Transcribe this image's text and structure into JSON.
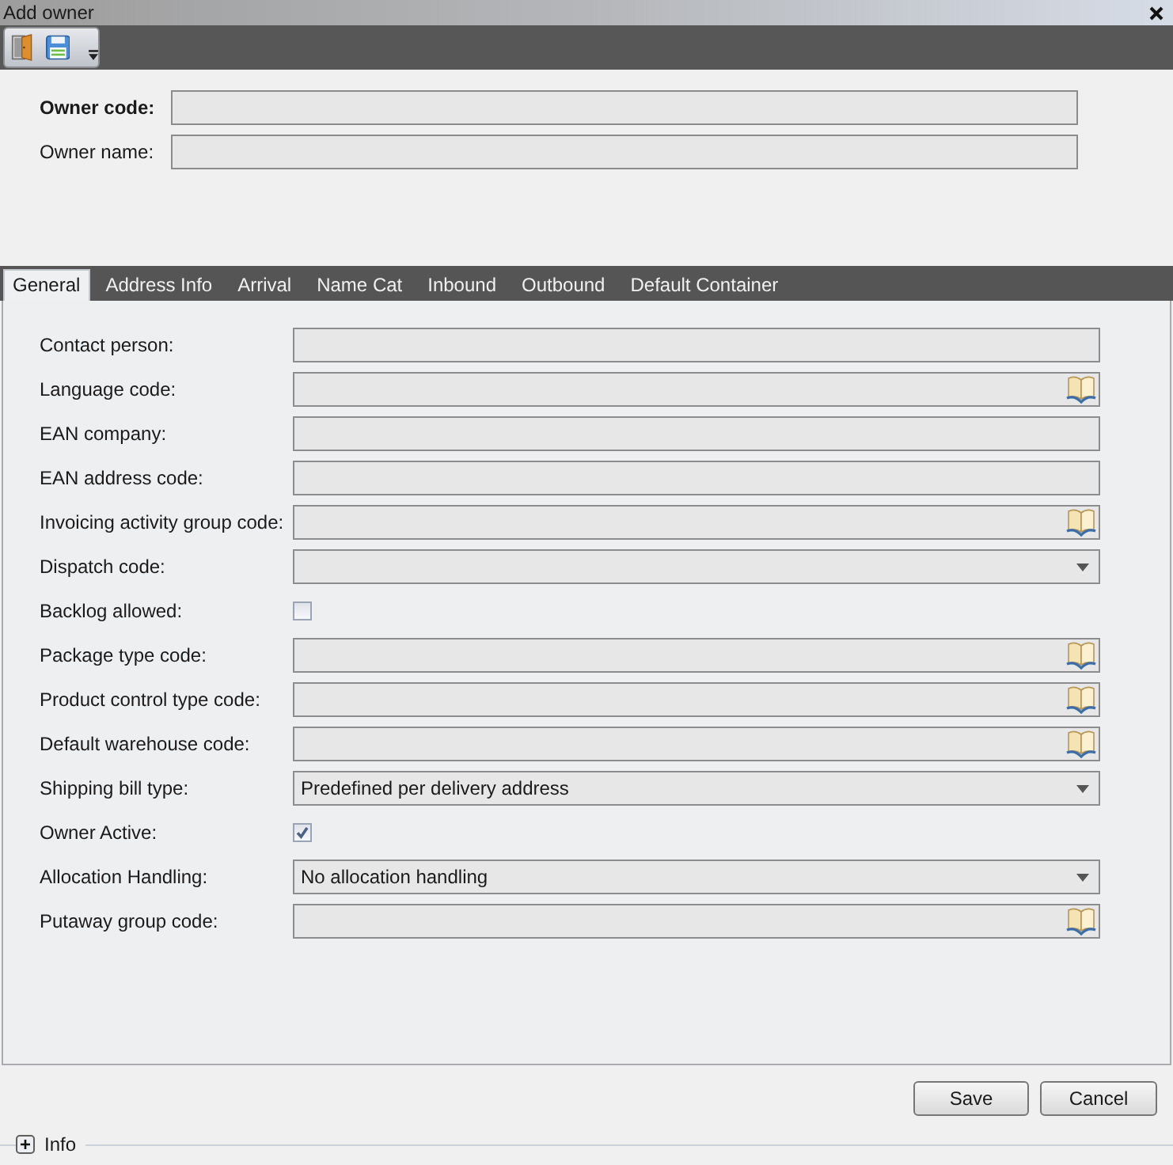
{
  "window": {
    "title": "Add owner"
  },
  "header": {
    "fields": [
      {
        "label": "Owner code:",
        "required": true
      },
      {
        "label": "Owner name:",
        "required": false
      }
    ]
  },
  "tabs": [
    {
      "label": "General",
      "selected": true
    },
    {
      "label": "Address Info",
      "selected": false
    },
    {
      "label": "Arrival",
      "selected": false
    },
    {
      "label": "Name Cat",
      "selected": false
    },
    {
      "label": "Inbound",
      "selected": false
    },
    {
      "label": "Outbound",
      "selected": false
    },
    {
      "label": "Default Container",
      "selected": false
    }
  ],
  "form": {
    "rows": [
      {
        "label": "Contact person:",
        "kind": "text"
      },
      {
        "label": "Language code:",
        "kind": "lookup"
      },
      {
        "label": "EAN company:",
        "kind": "text"
      },
      {
        "label": "EAN address code:",
        "kind": "text"
      },
      {
        "label": "Invoicing activity group code:",
        "kind": "lookup"
      },
      {
        "label": "Dispatch code:",
        "kind": "dropdown"
      },
      {
        "label": "Backlog allowed:",
        "kind": "checkbox",
        "checked": false
      },
      {
        "label": "Package type code:",
        "kind": "lookup"
      },
      {
        "label": "Product control type code:",
        "kind": "lookup"
      },
      {
        "label": "Default warehouse code:",
        "kind": "lookup"
      },
      {
        "label": "Shipping bill type:",
        "kind": "dropdown",
        "value": "Predefined per delivery address"
      },
      {
        "label": "Owner Active:",
        "kind": "checkbox",
        "checked": true
      },
      {
        "label": "Allocation Handling:",
        "kind": "dropdown",
        "value": "No allocation handling"
      },
      {
        "label": "Putaway group code:",
        "kind": "lookup"
      }
    ]
  },
  "buttons": [
    "Save",
    "Cancel"
  ],
  "info_panel": {
    "label": "Info",
    "expanded": false
  }
}
